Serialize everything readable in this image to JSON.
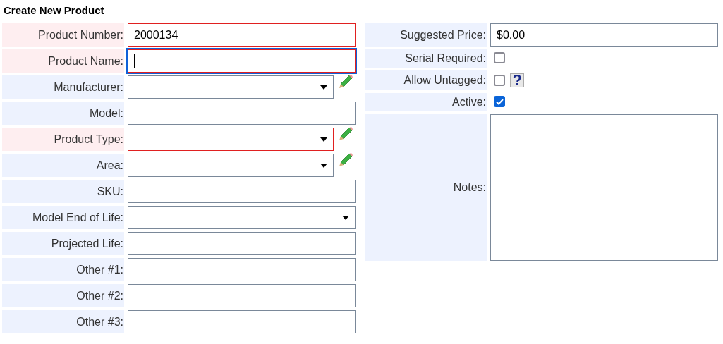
{
  "title": "Create New Product",
  "left_fields": [
    {
      "label": "Product Number:",
      "kind": "text",
      "value": "2000134",
      "required": true,
      "focused": false,
      "edit_button": false
    },
    {
      "label": "Product Name:",
      "kind": "text",
      "required": true,
      "focused": true,
      "edit_button": false
    },
    {
      "label": "Manufacturer:",
      "kind": "select",
      "required": false,
      "focused": false,
      "edit_button": true
    },
    {
      "label": "Model:",
      "kind": "text",
      "required": false,
      "focused": false,
      "edit_button": false
    },
    {
      "label": "Product Type:",
      "kind": "select",
      "required": true,
      "focused": false,
      "edit_button": true
    },
    {
      "label": "Area:",
      "kind": "select",
      "required": false,
      "focused": false,
      "edit_button": true
    },
    {
      "label": "SKU:",
      "kind": "text",
      "required": false,
      "focused": false,
      "edit_button": false
    },
    {
      "label": "Model End of Life:",
      "kind": "select",
      "required": false,
      "focused": false,
      "edit_button": false
    },
    {
      "label": "Projected Life:",
      "kind": "text",
      "required": false,
      "focused": false,
      "edit_button": false
    },
    {
      "label": "Other #1:",
      "kind": "text",
      "required": false,
      "focused": false,
      "edit_button": false
    },
    {
      "label": "Other #2:",
      "kind": "text",
      "required": false,
      "focused": false,
      "edit_button": false
    },
    {
      "label": "Other #3:",
      "kind": "text",
      "required": false,
      "focused": false,
      "edit_button": false
    }
  ],
  "right_fields": [
    {
      "label": "Suggested Price:",
      "kind": "text",
      "value": "$0.00"
    },
    {
      "label": "Serial Required:",
      "kind": "checkbox",
      "checked": false,
      "help": false
    },
    {
      "label": "Allow Untagged:",
      "kind": "checkbox",
      "checked": false,
      "help": true
    },
    {
      "label": "Active:",
      "kind": "checkbox",
      "checked": true,
      "help": false
    },
    {
      "label": "Notes:",
      "kind": "textarea"
    }
  ]
}
